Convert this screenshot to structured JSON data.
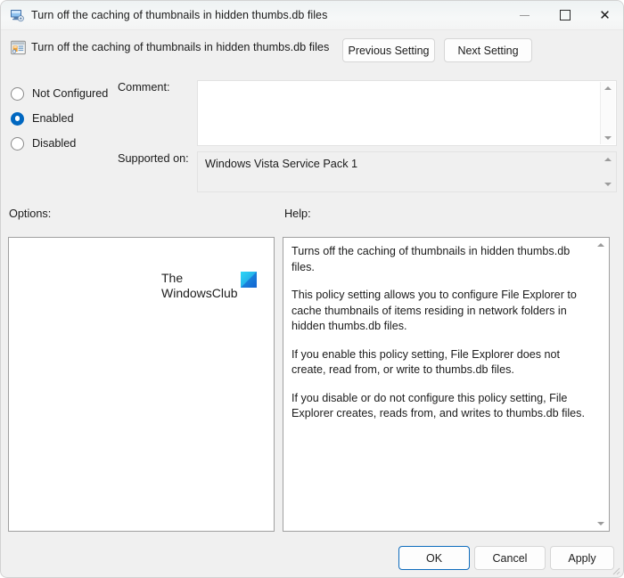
{
  "window": {
    "title": "Turn off the caching of thumbnails in hidden thumbs.db files",
    "title_icon": "computer-policy-icon",
    "controls": {
      "minimize": "minimize-icon",
      "maximize": "maximize-icon",
      "close": "close-icon"
    }
  },
  "header": {
    "icon": "policy-setting-icon",
    "policy_name": "Turn off the caching of thumbnails in hidden thumbs.db files",
    "previous_setting": "Previous Setting",
    "next_setting": "Next Setting"
  },
  "state": {
    "options": [
      {
        "label": "Not Configured",
        "selected": false
      },
      {
        "label": "Enabled",
        "selected": true
      },
      {
        "label": "Disabled",
        "selected": false
      }
    ]
  },
  "comment": {
    "label": "Comment:",
    "value": "",
    "scrollbar": {
      "up": "scroll-up-arrow-icon",
      "down": "scroll-down-arrow-icon"
    }
  },
  "supported": {
    "label": "Supported on:",
    "value": "Windows Vista Service Pack 1"
  },
  "options_section": {
    "label": "Options:",
    "content": ""
  },
  "help_section": {
    "label": "Help:",
    "paragraphs": [
      "Turns off the caching of thumbnails in hidden thumbs.db files.",
      "This policy setting allows you to configure File Explorer to cache thumbnails of items residing in network folders in hidden thumbs.db files.",
      "If you enable this policy setting, File Explorer does not create, read from, or write to thumbs.db files.",
      "If you disable or do not configure this policy setting, File Explorer creates, reads from, and writes to thumbs.db files."
    ]
  },
  "watermark": {
    "line1": "The",
    "line2": "WindowsClub",
    "logo": "windowsclub-logo-icon"
  },
  "footer": {
    "ok": "OK",
    "cancel": "Cancel",
    "apply": "Apply"
  },
  "colors": {
    "accent": "#0067c0",
    "focus_border": "#0f6cbd",
    "dialog_bg": "#f0f0f0",
    "titlebar_bg": "#f3f6f6",
    "panel_border": "#a0a0a0",
    "logo_start": "#00c8f0",
    "logo_end": "#0a57c8"
  }
}
